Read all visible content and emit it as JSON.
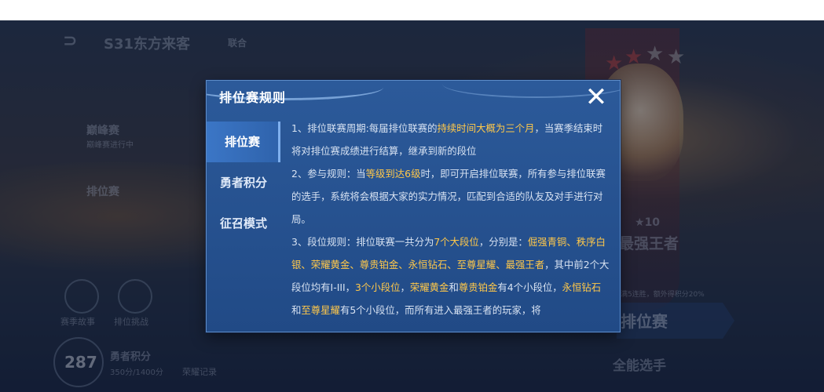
{
  "background": {
    "season_title": "S31东方来客",
    "season_sub": "联合",
    "left_menu": [
      "巅峰赛",
      "排位赛"
    ],
    "left_menu_sub": "巅峰赛进行中",
    "bottom_left_labels": [
      "赛季故事",
      "排位挑战"
    ],
    "bravery": {
      "label": "勇者积分",
      "value": "287",
      "sub": "350分/1400分"
    },
    "honor_record": "荣耀记录",
    "rank": {
      "stars": "10",
      "name": "最强王者"
    },
    "rank_note": "满5连胜，额外得积分20%",
    "play_button": "排位赛",
    "all_round": "全能选手"
  },
  "dialog": {
    "title": "排位赛规则",
    "close_icon": "close-icon",
    "tabs": [
      {
        "label": "排位赛",
        "active": true
      },
      {
        "label": "勇者积分",
        "active": false
      },
      {
        "label": "征召模式",
        "active": false
      }
    ],
    "rules": [
      {
        "segments": [
          {
            "text": "1、排位联赛周期:每届排位联赛的",
            "hl": false
          },
          {
            "text": "持续时间大概为三个月",
            "hl": true
          },
          {
            "text": "，当赛季结束时将对排位赛成绩进行结算，继承到新的段位",
            "hl": false
          }
        ]
      },
      {
        "segments": [
          {
            "text": "2、参与规则：当",
            "hl": false
          },
          {
            "text": "等级到达6级",
            "hl": true
          },
          {
            "text": "时，即可开启排位联赛，所有参与排位联赛的选手，系统将会根据大家的实力情况，匹配到合适的队友及对手进行对局。",
            "hl": false
          }
        ]
      },
      {
        "segments": [
          {
            "text": "3、段位规则：排位联赛一共分为",
            "hl": false
          },
          {
            "text": "7个大段位",
            "hl": true
          },
          {
            "text": "，分别是：",
            "hl": false
          },
          {
            "text": "倔强青铜、秩序白银、荣耀黄金、尊贵铂金、永恒钻石、至尊星耀、最强王者",
            "hl": true
          },
          {
            "text": "，其中前2个大段位均有I-III，",
            "hl": false
          },
          {
            "text": "3个小段位",
            "hl": true
          },
          {
            "text": "，",
            "hl": false
          },
          {
            "text": "荣耀黄金",
            "hl": true
          },
          {
            "text": "和",
            "hl": false
          },
          {
            "text": "尊贵铂金",
            "hl": true
          },
          {
            "text": "有4个小段位，",
            "hl": false
          },
          {
            "text": "永恒钻石",
            "hl": true
          },
          {
            "text": "和",
            "hl": false
          },
          {
            "text": "至尊星耀",
            "hl": true
          },
          {
            "text": "有5个小段位，而所有进入最强王者的玩家，将",
            "hl": false
          }
        ]
      }
    ]
  },
  "colors": {
    "highlight": "#ffc84a",
    "dialog_bg": "#214a86",
    "text": "#d7e2f2"
  }
}
